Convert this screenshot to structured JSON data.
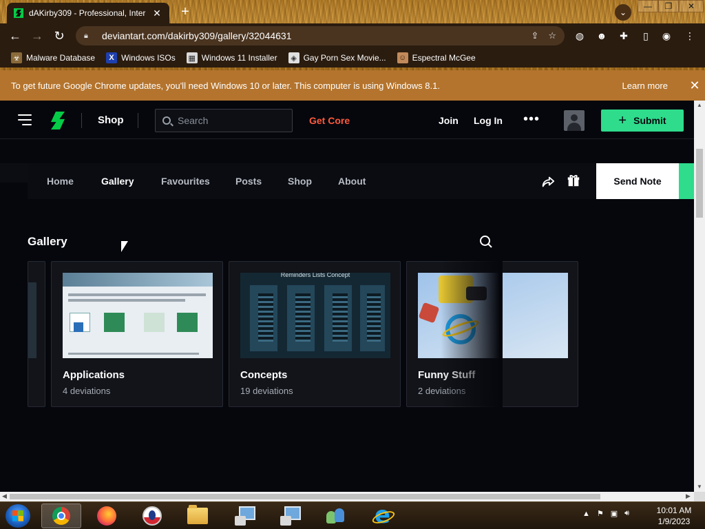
{
  "browser": {
    "tab_title": "dAKirby309 - Professional, Inter",
    "url": "deviantart.com/dakirby309/gallery/32044631",
    "bookmarks": [
      {
        "label": "Malware Database",
        "icon": "malware-icon"
      },
      {
        "label": "Windows ISOs",
        "icon": "x-icon"
      },
      {
        "label": "Windows 11 Installer",
        "icon": "installer-icon"
      },
      {
        "label": "Gay Porn Sex Movie...",
        "icon": "media-icon"
      },
      {
        "label": "Espectral McGee",
        "icon": "avatar-icon"
      }
    ],
    "infobar": {
      "message": "To get future Google Chrome updates, you'll need Windows 10 or later. This computer is using Windows 8.1.",
      "learn_more": "Learn more"
    }
  },
  "header": {
    "shop": "Shop",
    "search_placeholder": "Search",
    "get_core": "Get Core",
    "join": "Join",
    "login": "Log In",
    "more": "•••",
    "submit": "Submit"
  },
  "subnav": {
    "items": [
      "Home",
      "Gallery",
      "Favourites",
      "Posts",
      "Shop",
      "About"
    ],
    "active": "Gallery",
    "send_note": "Send Note"
  },
  "gallery": {
    "title": "Gallery",
    "folders": [
      {
        "name": "Applications",
        "count": "4 deviations"
      },
      {
        "name": "Concepts",
        "count": "19 deviations"
      },
      {
        "name": "Funny Stuff",
        "count": "2 deviations"
      }
    ],
    "concepts_thumb_caption": "Reminders Lists Concept"
  },
  "taskbar": {
    "time": "10:01 AM",
    "date": "1/9/2023"
  },
  "colors": {
    "accent_green": "#2edc8c",
    "core_orange": "#ff5a3c",
    "infobar": "#b4742d"
  }
}
